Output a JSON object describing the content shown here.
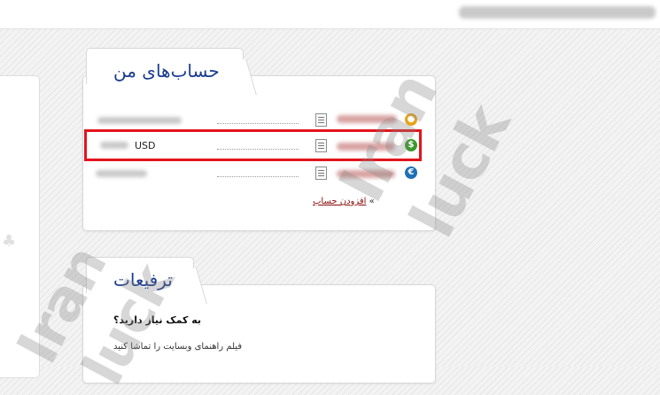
{
  "accounts_panel": {
    "title": "حساب‌های من",
    "rows": [
      {
        "currency": "",
        "coin_icon": "gold-coin-icon",
        "coin_glyph": "⬤",
        "coin_color": "#e9a317"
      },
      {
        "currency": "USD",
        "coin_icon": "dollar-coin-icon",
        "coin_glyph": "$",
        "coin_color": "#3b9a2c"
      },
      {
        "currency": "",
        "coin_icon": "euro-coin-icon",
        "coin_glyph": "€",
        "coin_color": "#1f6fb5"
      }
    ],
    "add_account": {
      "arrow": "»",
      "label": "افزودن حساب"
    },
    "highlight_color": "#e3141c"
  },
  "promotions_panel": {
    "title": "ترفیعات",
    "help_heading": "به کمک نیاز دارید؟",
    "help_text": "فیلم راهنمای وبسایت را تماشا کنید"
  },
  "watermark": {
    "line1": "Iran",
    "line2": "luck"
  },
  "colors": {
    "title_blue": "#1a3b8f",
    "link_red": "#8a0b0b"
  }
}
